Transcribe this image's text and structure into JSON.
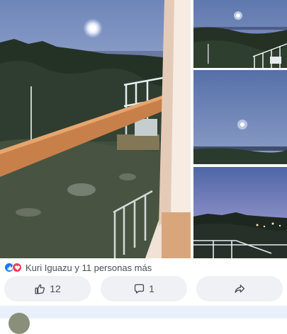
{
  "post": {
    "photos": [
      {
        "label": "balcony-moonrise-main"
      },
      {
        "label": "moon-over-hills-thumb"
      },
      {
        "label": "moon-blue-sky-thumb"
      },
      {
        "label": "dusk-village-lights-thumb"
      }
    ],
    "reactions": {
      "icons": [
        "like-icon",
        "love-icon"
      ],
      "text": "Kuri Iguazu y 11 personas más"
    },
    "actions": {
      "like_count": "12",
      "comment_count": "1"
    }
  },
  "colors": {
    "accent": "#1877f2",
    "love": "#f33e58",
    "button_bg": "#eff1f4",
    "text_secondary": "#4b4f56"
  }
}
